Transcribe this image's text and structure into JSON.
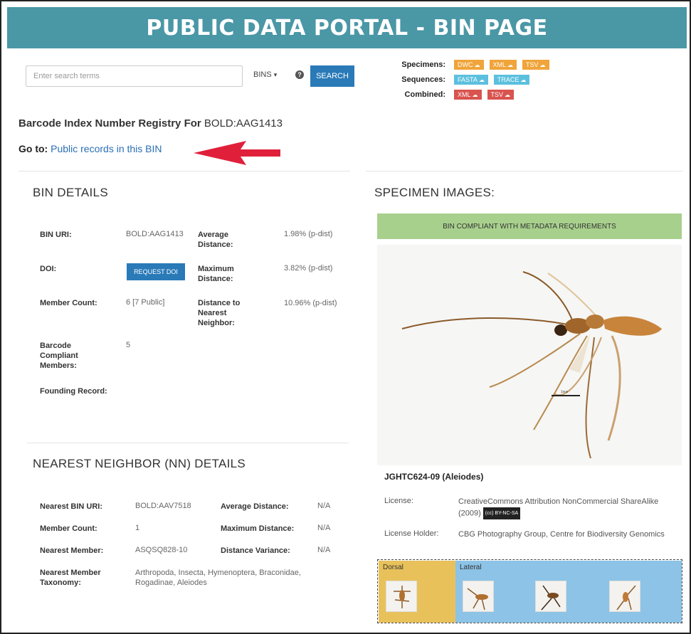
{
  "header": {
    "title": "PUBLIC DATA PORTAL - BIN PAGE"
  },
  "search": {
    "placeholder": "Enter search terms",
    "scope": "BINS",
    "scope_caret": "▾",
    "help": "?",
    "button": "SEARCH"
  },
  "downloads": {
    "specimens_label": "Specimens:",
    "sequences_label": "Sequences:",
    "combined_label": "Combined:",
    "specimens": [
      "DWC",
      "XML",
      "TSV"
    ],
    "sequences": [
      "FASTA",
      "TRACE"
    ],
    "combined": [
      "XML",
      "TSV"
    ]
  },
  "registry": {
    "prefix": "Barcode Index Number Registry For",
    "bin": "BOLD:AAG1413"
  },
  "goto": {
    "label": "Go to:",
    "link": "Public records in this BIN"
  },
  "bin_details": {
    "title": "BIN DETAILS",
    "uri_label": "BIN URI:",
    "uri": "BOLD:AAG1413",
    "avg_label": "Average Distance:",
    "avg": "1.98% (p-dist)",
    "doi_label": "DOI:",
    "doi_button": "REQUEST DOI",
    "max_label": "Maximum Distance:",
    "max": "3.82% (p-dist)",
    "member_label": "Member Count:",
    "member": "6 [7 Public]",
    "nn_dist_label": "Distance to Nearest Neighbor:",
    "nn_dist": "10.96% (p-dist)",
    "compliant_label": "Barcode Compliant Members:",
    "compliant": "5",
    "founding_label": "Founding Record:"
  },
  "nn_details": {
    "title": "NEAREST NEIGHBOR (NN) DETAILS",
    "uri_label": "Nearest BIN URI:",
    "uri": "BOLD:AAV7518",
    "avg_label": "Average Distance:",
    "avg": "N/A",
    "count_label": "Member Count:",
    "count": "1",
    "max_label": "Maximum Distance:",
    "max": "N/A",
    "member_label": "Nearest Member:",
    "member": "ASQSQ828-10",
    "var_label": "Distance Variance:",
    "var": "N/A",
    "tax_label": "Nearest Member Taxonomy:",
    "tax": "Arthropoda, Insecta, Hymenoptera, Braconidae, Rogadinae, Aleiodes"
  },
  "specimen": {
    "title": "SPECIMEN IMAGES:",
    "compliance": "BIN COMPLIANT WITH METADATA REQUIREMENTS",
    "id": "JGHTC624-09 (Aleiodes)",
    "license_label": "License:",
    "license": "CreativeCommons Attribution NonCommercial ShareAlike (2009)",
    "cc_badge": "(cc) BY-NC-SA",
    "holder_label": "License Holder:",
    "holder": "CBG Photography Group, Centre for Biodiversity Genomics",
    "views": {
      "dorsal": "Dorsal",
      "lateral": "Lateral"
    }
  },
  "colors": {
    "header": "#4a97a6",
    "primary_button": "#2a7ab8",
    "chip_orange": "#f0a43a",
    "chip_blue": "#5bc0de",
    "chip_red": "#d9534f",
    "compliance_bg": "#a8d08d",
    "arrow": "#e0203a"
  }
}
